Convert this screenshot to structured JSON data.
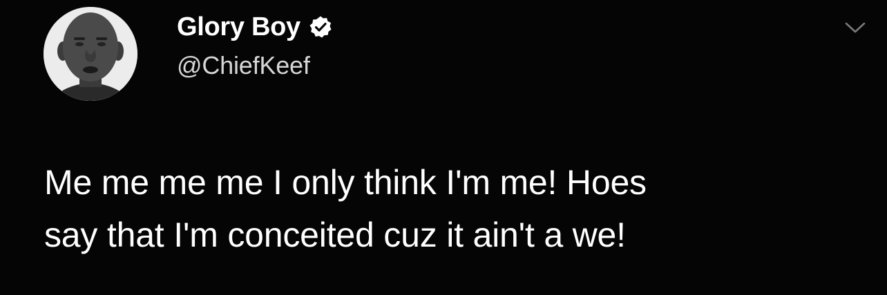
{
  "author": {
    "display_name": "Glory Boy",
    "handle": "@ChiefKeef",
    "verified": true,
    "avatar_icon": "profile-photo"
  },
  "tweet": {
    "lines": [
      "Me me me me I only think I'm me! Hoes",
      "say that I'm conceited cuz it ain't a we!"
    ]
  },
  "icons": {
    "verified": "verified-badge-icon",
    "menu": "chevron-down-icon"
  },
  "colors": {
    "background": "#050505",
    "text": "#ffffff",
    "handle_text": "#d6d6d6"
  }
}
